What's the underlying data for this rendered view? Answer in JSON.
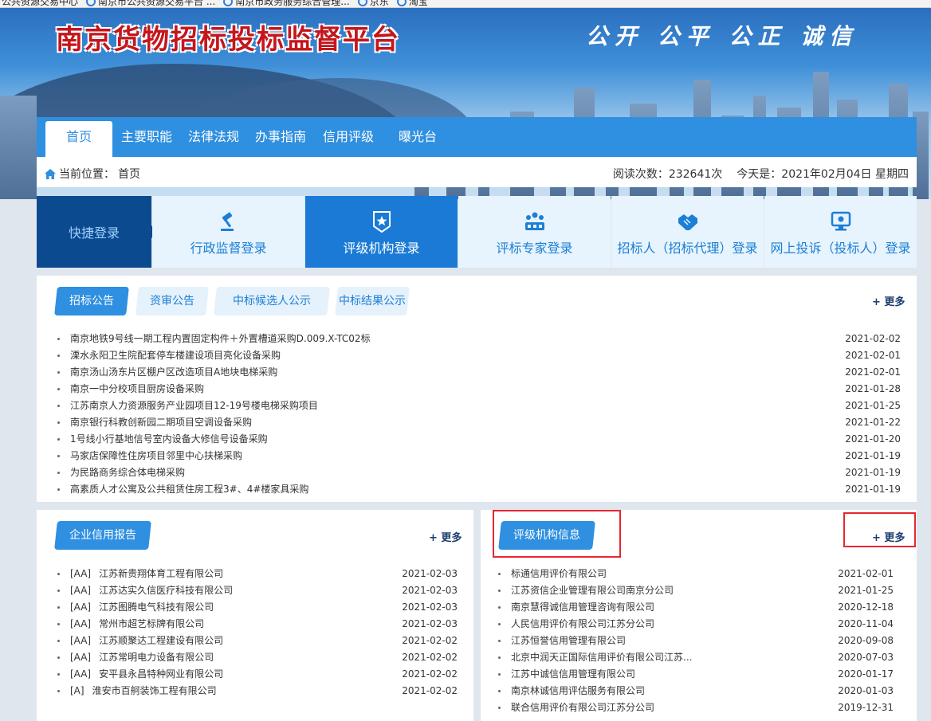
{
  "browser": {
    "favorites": [
      "公共资源交易中心",
      "南京市公共资源交易平台 ...",
      "南京市政务服务综合管理...",
      "京东",
      "淘宝"
    ]
  },
  "header": {
    "title": "南京货物招标投标监督平台",
    "slogan": "公开 公平 公正 诚信"
  },
  "nav": {
    "items": [
      "首页",
      "主要职能",
      "法律法规",
      "办事指南",
      "信用评级",
      "曝光台"
    ],
    "active_index": 0
  },
  "breadcrumb": {
    "label": "当前位置：",
    "page": "首页",
    "visits": "阅读次数：232641次",
    "today": "今天是：2021年02月04日 星期四"
  },
  "quick_login": {
    "label": "快捷登录",
    "buttons": [
      {
        "label": "行政监督登录",
        "icon": "gavel-icon"
      },
      {
        "label": "评级机构登录",
        "icon": "badge-star-icon"
      },
      {
        "label": "评标专家登录",
        "icon": "group-icon"
      },
      {
        "label": "招标人（招标代理）登录",
        "icon": "handshake-icon"
      },
      {
        "label": "网上投诉（投标人）登录",
        "icon": "monitor-icon"
      }
    ],
    "active_index": 1
  },
  "notices": {
    "tabs": [
      "招标公告",
      "资审公告",
      "中标候选人公示",
      "中标结果公示"
    ],
    "active_tab": 0,
    "more": "更多",
    "items": [
      {
        "title": "南京地铁9号线一期工程内置固定构件＋外置槽道采购D.009.X-TC02标",
        "date": "2021-02-02"
      },
      {
        "title": "溧水永阳卫生院配套停车楼建设项目亮化设备采购",
        "date": "2021-02-01"
      },
      {
        "title": "南京汤山汤东片区棚户区改造项目A地块电梯采购",
        "date": "2021-02-01"
      },
      {
        "title": "南京一中分校项目厨房设备采购",
        "date": "2021-01-28"
      },
      {
        "title": "江苏南京人力资源服务产业园项目12-19号楼电梯采购项目",
        "date": "2021-01-25"
      },
      {
        "title": "南京银行科教创新园二期项目空调设备采购",
        "date": "2021-01-22"
      },
      {
        "title": "1号线小行基地信号室内设备大修信号设备采购",
        "date": "2021-01-20"
      },
      {
        "title": "马家店保障性住房项目邻里中心扶梯采购",
        "date": "2021-01-19"
      },
      {
        "title": "为民路商务综合体电梯采购",
        "date": "2021-01-19"
      },
      {
        "title": "高素质人才公寓及公共租赁住房工程3#、4#楼家具采购",
        "date": "2021-01-19"
      }
    ]
  },
  "credit_reports": {
    "tab": "企业信用报告",
    "more": "更多",
    "items": [
      {
        "rating": "[AA]",
        "name": "江苏新贵翔体育工程有限公司",
        "date": "2021-02-03"
      },
      {
        "rating": "[AA]",
        "name": "江苏达实久信医疗科技有限公司",
        "date": "2021-02-03"
      },
      {
        "rating": "[AA]",
        "name": "江苏图腾电气科技有限公司",
        "date": "2021-02-03"
      },
      {
        "rating": "[AA]",
        "name": "常州市超艺标牌有限公司",
        "date": "2021-02-03"
      },
      {
        "rating": "[AA]",
        "name": "江苏顺聚达工程建设有限公司",
        "date": "2021-02-02"
      },
      {
        "rating": "[AA]",
        "name": "江苏常明电力设备有限公司",
        "date": "2021-02-02"
      },
      {
        "rating": "[AA]",
        "name": "安平县永昌特种网业有限公司",
        "date": "2021-02-02"
      },
      {
        "rating": "[A]",
        "name": "淮安市百舸装饰工程有限公司",
        "date": "2021-02-02"
      }
    ]
  },
  "rating_agencies": {
    "tab": "评级机构信息",
    "more": "更多",
    "items": [
      {
        "name": "标通信用评价有限公司",
        "date": "2021-02-01"
      },
      {
        "name": "江苏资信企业管理有限公司南京分公司",
        "date": "2021-01-25"
      },
      {
        "name": "南京慧得诚信用管理咨询有限公司",
        "date": "2020-12-18"
      },
      {
        "name": "人民信用评价有限公司江苏分公司",
        "date": "2020-11-04"
      },
      {
        "name": "江苏恒誉信用管理有限公司",
        "date": "2020-09-08"
      },
      {
        "name": "北京中润天正国际信用评价有限公司江苏...",
        "date": "2020-07-03"
      },
      {
        "name": "江苏中诚信信用管理有限公司",
        "date": "2020-01-17"
      },
      {
        "name": "南京林诚信用评估服务有限公司",
        "date": "2020-01-03"
      },
      {
        "name": "联合信用评价有限公司江苏分公司",
        "date": "2019-12-31"
      }
    ]
  },
  "colors": {
    "nav_blue": "#2f8fe0",
    "title_red": "#c4161c",
    "quick_dark": "#0c4a8f",
    "highlight_red": "#e8262e"
  }
}
